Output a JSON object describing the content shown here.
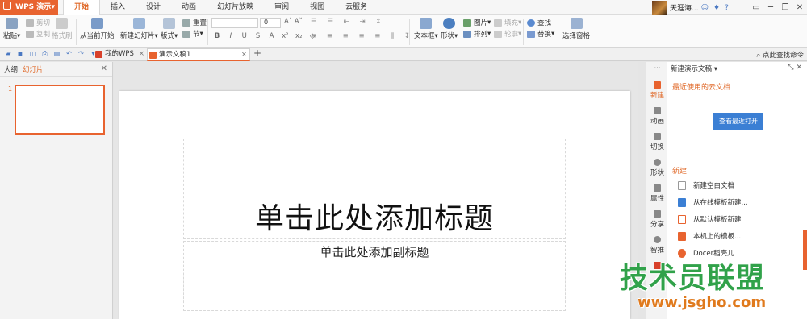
{
  "app": {
    "name": "WPS 演示",
    "caret": "▾"
  },
  "menu_tabs": [
    "开始",
    "插入",
    "设计",
    "动画",
    "幻灯片放映",
    "审阅",
    "视图",
    "云服务"
  ],
  "user": {
    "name": "天涯海..."
  },
  "window_controls": [
    "▭",
    "─",
    "❐",
    "✕"
  ],
  "ribbon": {
    "paste": "粘贴",
    "cut": "剪切",
    "copy": "复制",
    "format_painter": "格式刷",
    "from_current": "从当前开始",
    "new_slide": "新建幻灯片",
    "layout": "版式",
    "reset": "重置",
    "section": "节",
    "font_size": "0",
    "bold": "B",
    "italic": "I",
    "underline": "U",
    "strike": "S",
    "textbox": "文本框",
    "shape": "形状",
    "picture": "图片",
    "fill": "填充",
    "arrange": "排列",
    "outline": "轮廓",
    "find": "查找",
    "replace": "替换",
    "select_pane": "选择窗格"
  },
  "doc_tabs": [
    {
      "label": "我的WPS",
      "active": false
    },
    {
      "label": "演示文稿1",
      "active": true
    }
  ],
  "search_cmd": "点此查找命令",
  "left_pane": {
    "outline_tab": "大纲",
    "slides_tab": "幻灯片",
    "slide_number": "1"
  },
  "slide": {
    "title": "单击此处添加标题",
    "subtitle": "单击此处添加副标题"
  },
  "right_strip": [
    "新建",
    "动画",
    "切换",
    "形状",
    "属性",
    "分享",
    "智推"
  ],
  "task_pane": {
    "header": "新建演示文稿",
    "recent_title": "最近使用的云文档",
    "open_recent": "查看最近打开",
    "new_title": "新建",
    "items": [
      "新建空白文档",
      "从在线模板新建...",
      "从默认模板新建",
      "本机上的模板...",
      "Docer稻壳儿"
    ]
  },
  "watermark": {
    "text": "技术员联盟",
    "url": "www.jsgho.com"
  },
  "colors": {
    "accent": "#e8632f",
    "tab_active_text": "#e06a2a",
    "button_blue": "#3b7fd4",
    "watermark_green": "#31a24a"
  }
}
